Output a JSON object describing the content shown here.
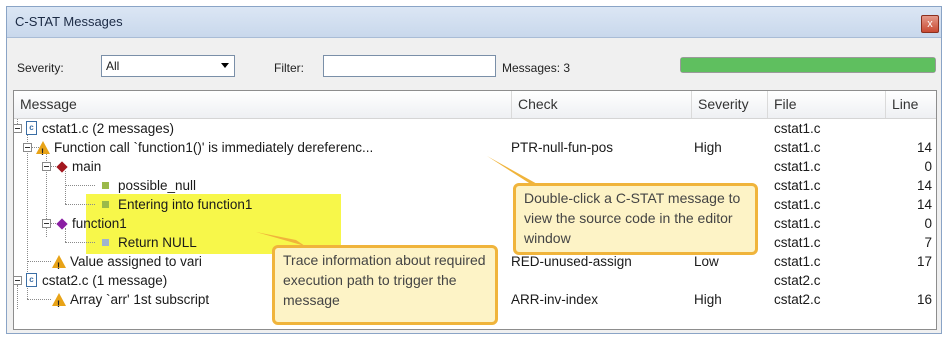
{
  "window": {
    "title": "C-STAT Messages",
    "close_glyph": "x"
  },
  "toolbar": {
    "severity_label": "Severity:",
    "severity_value": "All",
    "filter_label": "Filter:",
    "filter_value": "",
    "messages_count": "Messages: 3",
    "progress": 1.0
  },
  "columns": [
    "Message",
    "Check",
    "Severity",
    "File",
    "Line"
  ],
  "rows": [
    {
      "message": "cstat1.c  (2 messages)",
      "check": "",
      "severity": "",
      "file": "cstat1.c",
      "line": ""
    },
    {
      "message": "Function call `function1()' is immediately dereferenc...",
      "check": "PTR-null-fun-pos",
      "severity": "High",
      "file": "cstat1.c",
      "line": "14"
    },
    {
      "message": "main",
      "check": "",
      "severity": "",
      "file": "cstat1.c",
      "line": "0"
    },
    {
      "message": "possible_null",
      "check": "",
      "severity": "",
      "file": "cstat1.c",
      "line": "14"
    },
    {
      "message": "Entering into function1",
      "check": "",
      "severity": "",
      "file": "cstat1.c",
      "line": "14"
    },
    {
      "message": "function1",
      "check": "",
      "severity": "",
      "file": "cstat1.c",
      "line": "0"
    },
    {
      "message": "Return NULL",
      "check": "",
      "severity": "",
      "file": "cstat1.c",
      "line": "7"
    },
    {
      "message": "Value assigned to vari",
      "check": "RED-unused-assign",
      "severity": "Low",
      "file": "cstat1.c",
      "line": "17"
    },
    {
      "message": "cstat2.c  (1 message)",
      "check": "",
      "severity": "",
      "file": "cstat2.c",
      "line": ""
    },
    {
      "message": "Array `arr' 1st subscript",
      "check": "ARR-inv-index",
      "severity": "High",
      "file": "cstat2.c",
      "line": "16"
    }
  ],
  "callouts": {
    "double_click": "Double-click a C-STAT message to view the source code in the editor window",
    "trace": "Trace information about required execution path to trigger the message"
  },
  "colors": {
    "warning": "#e8a317",
    "diamond_red": "#a3171f",
    "diamond_purple": "#8a1fa3",
    "square_green": "#9bb94a",
    "square_blue": "#9fb3cf",
    "highlight": "#f7f74a",
    "callout_border": "#f0b43b"
  }
}
